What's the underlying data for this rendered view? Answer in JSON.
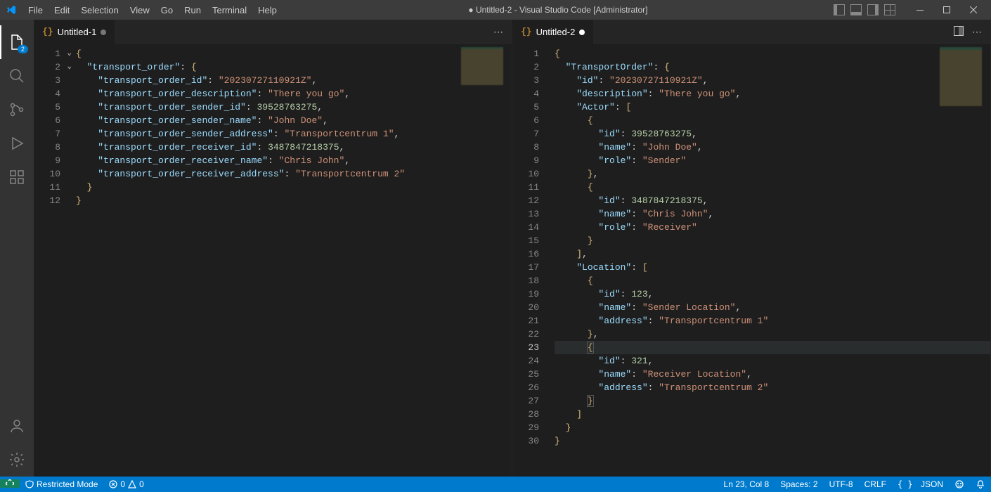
{
  "title": "● Untitled-2 - Visual Studio Code [Administrator]",
  "menu": [
    "File",
    "Edit",
    "Selection",
    "View",
    "Go",
    "Run",
    "Terminal",
    "Help"
  ],
  "activity": {
    "explorer_badge": "2"
  },
  "tabs": {
    "left": {
      "icon": "{}",
      "label": "Untitled-1"
    },
    "right": {
      "icon": "{}",
      "label": "Untitled-2"
    }
  },
  "leftCode": {
    "lines": [
      "1",
      "2",
      "3",
      "4",
      "5",
      "6",
      "7",
      "8",
      "9",
      "10",
      "11",
      "12"
    ],
    "l1_brace": "{",
    "l2_key": "\"transport_order\"",
    "l2_end": ": {",
    "l3_key": "\"transport_order_id\"",
    "l3_val": "\"20230727110921Z\"",
    "l4_key": "\"transport_order_description\"",
    "l4_val": "\"There you go\"",
    "l5_key": "\"transport_order_sender_id\"",
    "l5_val": "39528763275",
    "l6_key": "\"transport_order_sender_name\"",
    "l6_val": "\"John Doe\"",
    "l7_key": "\"transport_order_sender_address\"",
    "l7_val": "\"Transportcentrum 1\"",
    "l8_key": "\"transport_order_receiver_id\"",
    "l8_val": "3487847218375",
    "l9_key": "\"transport_order_receiver_name\"",
    "l9_val": "\"Chris John\"",
    "l10_key": "\"transport_order_receiver_address\"",
    "l10_val": "\"Transportcentrum 2\"",
    "l11_brace": "}",
    "l12_brace": "}"
  },
  "rightCode": {
    "lines": [
      "1",
      "2",
      "3",
      "4",
      "5",
      "6",
      "7",
      "8",
      "9",
      "10",
      "11",
      "12",
      "13",
      "14",
      "15",
      "16",
      "17",
      "18",
      "19",
      "20",
      "21",
      "22",
      "23",
      "24",
      "25",
      "26",
      "27",
      "28",
      "29",
      "30"
    ],
    "r1": "{",
    "r2_key": "\"TransportOrder\"",
    "r2_end": ": {",
    "r3_key": "\"id\"",
    "r3_val": "\"20230727110921Z\"",
    "r4_key": "\"description\"",
    "r4_val": "\"There you go\"",
    "r5_key": "\"Actor\"",
    "r5_end": ": [",
    "r6": "{",
    "r7_key": "\"id\"",
    "r7_val": "39528763275",
    "r8_key": "\"name\"",
    "r8_val": "\"John Doe\"",
    "r9_key": "\"role\"",
    "r9_val": "\"Sender\"",
    "r10": "},",
    "r11": "{",
    "r12_key": "\"id\"",
    "r12_val": "3487847218375",
    "r13_key": "\"name\"",
    "r13_val": "\"Chris John\"",
    "r14_key": "\"role\"",
    "r14_val": "\"Receiver\"",
    "r15": "}",
    "r16": "],",
    "r17_key": "\"Location\"",
    "r17_end": ": [",
    "r18": "{",
    "r19_key": "\"id\"",
    "r19_val": "123",
    "r20_key": "\"name\"",
    "r20_val": "\"Sender Location\"",
    "r21_key": "\"address\"",
    "r21_val": "\"Transportcentrum 1\"",
    "r22": "},",
    "r23": "{",
    "r24_key": "\"id\"",
    "r24_val": "321",
    "r25_key": "\"name\"",
    "r25_val": "\"Receiver Location\"",
    "r26_key": "\"address\"",
    "r26_val": "\"Transportcentrum 2\"",
    "r27": "}",
    "r28": "]",
    "r29": "}",
    "r30": "}"
  },
  "status": {
    "restricted": "Restricted Mode",
    "errors": "0",
    "warnings": "0",
    "ln_col": "Ln 23, Col 8",
    "spaces": "Spaces: 2",
    "encoding": "UTF-8",
    "eol": "CRLF",
    "lang": "JSON"
  }
}
